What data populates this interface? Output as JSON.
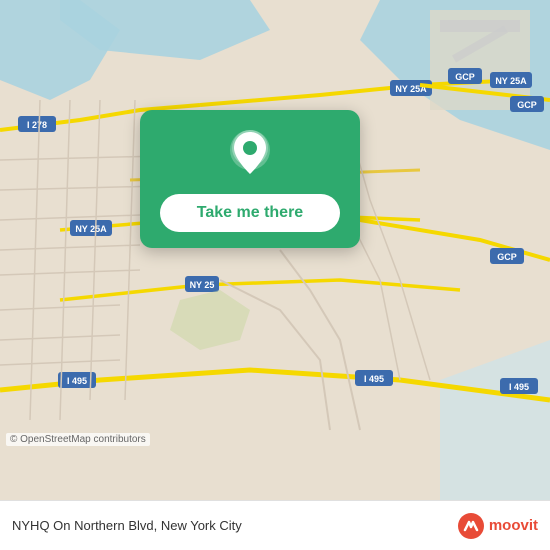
{
  "map": {
    "alt": "Map of Queens, New York City",
    "background_color": "#e8dfd0"
  },
  "action_card": {
    "icon_label": "location-pin",
    "button_label": "Take me there"
  },
  "footer": {
    "location_name": "NYHQ On Northern Blvd",
    "city": "New York City",
    "full_text": "NYHQ On Northern Blvd, New York City",
    "moovit_label": "moovit",
    "copyright": "© OpenStreetMap contributors"
  }
}
